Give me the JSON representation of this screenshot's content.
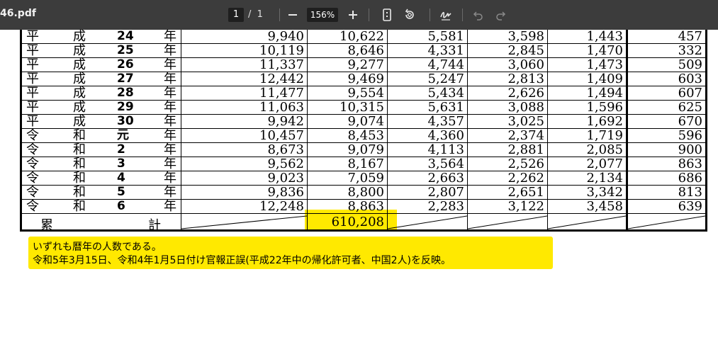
{
  "toolbar": {
    "filename": "46.pdf",
    "page_current": "1",
    "page_sep": "/",
    "page_total": "1",
    "zoom": "156%"
  },
  "table": {
    "rows": [
      {
        "era": [
          "平",
          "成",
          "24",
          "年"
        ],
        "v": [
          "9,940",
          "10,622",
          "5,581",
          "3,598",
          "1,443",
          "457"
        ]
      },
      {
        "era": [
          "平",
          "成",
          "25",
          "年"
        ],
        "v": [
          "10,119",
          "8,646",
          "4,331",
          "2,845",
          "1,470",
          "332"
        ]
      },
      {
        "era": [
          "平",
          "成",
          "26",
          "年"
        ],
        "v": [
          "11,337",
          "9,277",
          "4,744",
          "3,060",
          "1,473",
          "509"
        ]
      },
      {
        "era": [
          "平",
          "成",
          "27",
          "年"
        ],
        "v": [
          "12,442",
          "9,469",
          "5,247",
          "2,813",
          "1,409",
          "603"
        ]
      },
      {
        "era": [
          "平",
          "成",
          "28",
          "年"
        ],
        "v": [
          "11,477",
          "9,554",
          "5,434",
          "2,626",
          "1,494",
          "607"
        ]
      },
      {
        "era": [
          "平",
          "成",
          "29",
          "年"
        ],
        "v": [
          "11,063",
          "10,315",
          "5,631",
          "3,088",
          "1,596",
          "625"
        ]
      },
      {
        "era": [
          "平",
          "成",
          "30",
          "年"
        ],
        "v": [
          "9,942",
          "9,074",
          "4,357",
          "3,025",
          "1,692",
          "670"
        ]
      },
      {
        "era": [
          "令",
          "和",
          "元",
          "年"
        ],
        "v": [
          "10,457",
          "8,453",
          "4,360",
          "2,374",
          "1,719",
          "596"
        ]
      },
      {
        "era": [
          "令",
          "和",
          "2",
          "年"
        ],
        "v": [
          "8,673",
          "9,079",
          "4,113",
          "2,881",
          "2,085",
          "900"
        ]
      },
      {
        "era": [
          "令",
          "和",
          "3",
          "年"
        ],
        "v": [
          "9,562",
          "8,167",
          "3,564",
          "2,526",
          "2,077",
          "863"
        ]
      },
      {
        "era": [
          "令",
          "和",
          "4",
          "年"
        ],
        "v": [
          "9,023",
          "7,059",
          "2,663",
          "2,262",
          "2,134",
          "686"
        ]
      },
      {
        "era": [
          "令",
          "和",
          "5",
          "年"
        ],
        "v": [
          "9,836",
          "8,800",
          "2,807",
          "2,651",
          "3,342",
          "813"
        ]
      },
      {
        "era": [
          "令",
          "和",
          "6",
          "年"
        ],
        "v": [
          "12,248",
          "8,863",
          "2,283",
          "3,122",
          "3,458",
          "639"
        ]
      }
    ],
    "total_label_1": "累",
    "total_label_2": "計",
    "total_value": "610,208"
  },
  "notes": {
    "line1": "いずれも暦年の人数である。",
    "line2": "令和5年3月15日、令和4年1月5日付け官報正誤(平成22年中の帰化許可者、中国2人)を反映。"
  },
  "colors": {
    "toolbar_bg": "#3c3c3c",
    "highlight": "#ffe900"
  }
}
